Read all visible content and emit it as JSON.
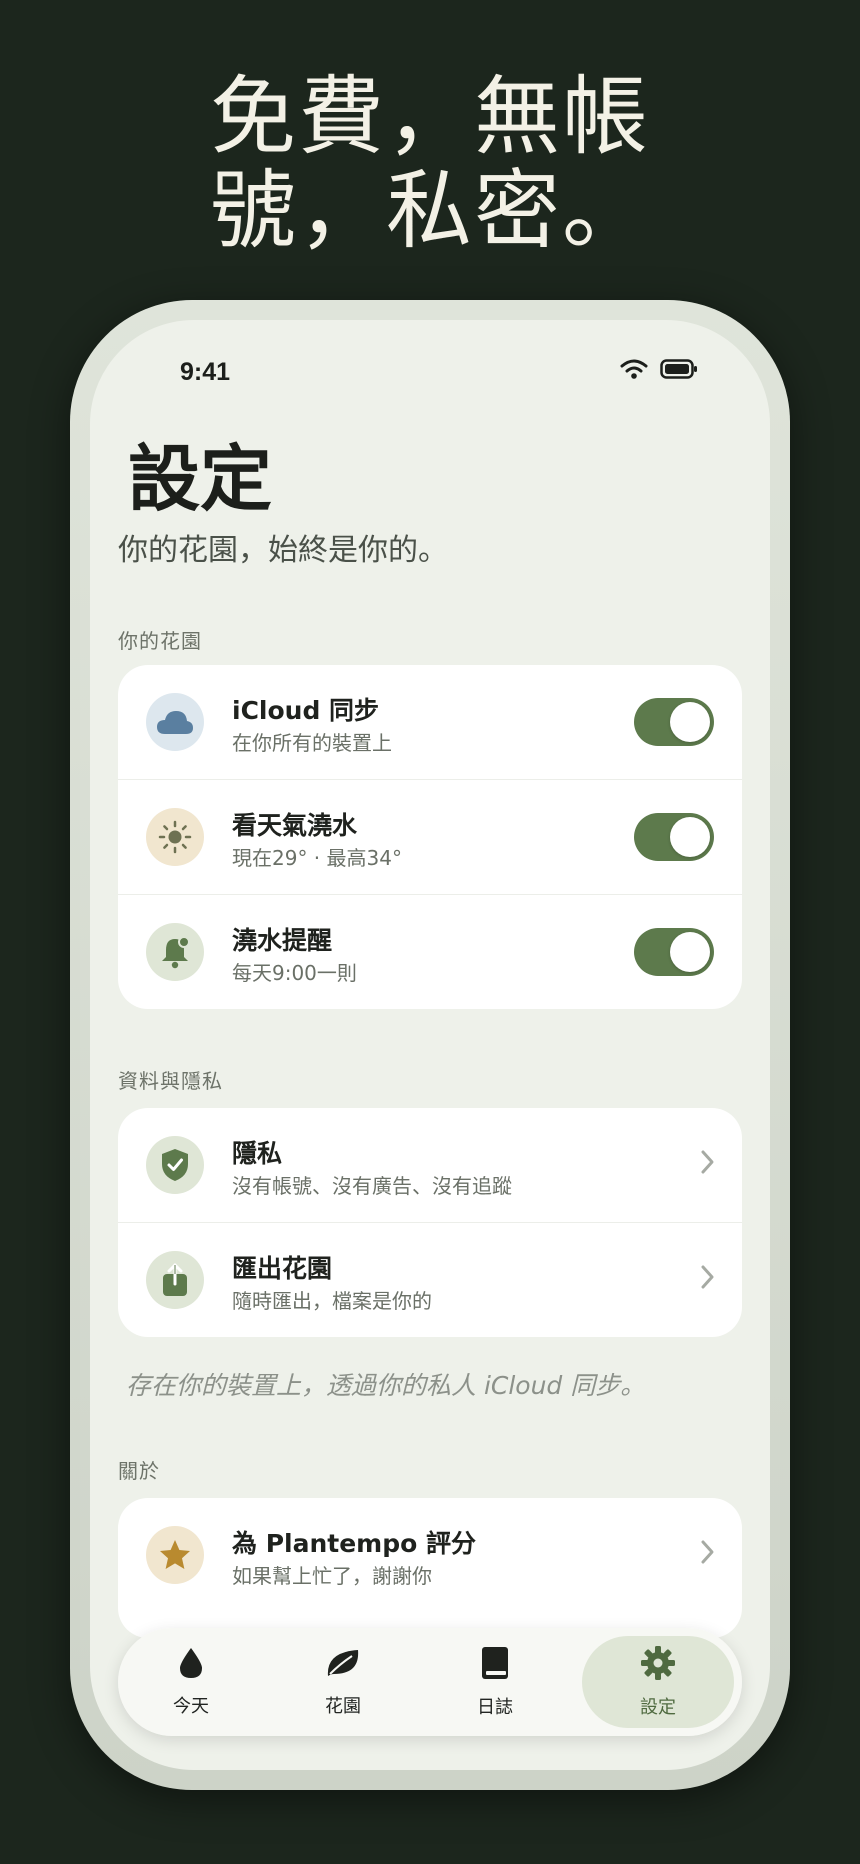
{
  "headline": {
    "line1": "免費，無帳",
    "line2": "號，私密。"
  },
  "status_bar": {
    "time": "9:41"
  },
  "page": {
    "title": "設定",
    "subtitle": "你的花園，始終是你的。"
  },
  "sections": {
    "garden": {
      "label": "你的花園",
      "rows": [
        {
          "title": "iCloud 同步",
          "subtitle": "在你所有的裝置上",
          "icon": "cloud-icon",
          "toggle_on": true
        },
        {
          "title": "看天氣澆水",
          "subtitle": "現在29° · 最高34°",
          "icon": "sun-icon",
          "toggle_on": true
        },
        {
          "title": "澆水提醒",
          "subtitle": "每天9:00一則",
          "icon": "bell-icon",
          "toggle_on": true
        }
      ]
    },
    "data_privacy": {
      "label": "資料與隱私",
      "rows": [
        {
          "title": "隱私",
          "subtitle": "沒有帳號、沒有廣告、沒有追蹤",
          "icon": "shield-check-icon"
        },
        {
          "title": "匯出花園",
          "subtitle": "隨時匯出，檔案是你的",
          "icon": "share-export-icon"
        }
      ],
      "footnote": "存在你的裝置上，透過你的私人 iCloud 同步。"
    },
    "about": {
      "label": "關於",
      "rows": [
        {
          "title": "為 Plantempo 評分",
          "subtitle": "如果幫上忙了，謝謝你",
          "icon": "star-icon"
        }
      ]
    }
  },
  "tabbar": {
    "tabs": [
      {
        "label": "今天",
        "icon": "drop-icon"
      },
      {
        "label": "花園",
        "icon": "leaf-icon"
      },
      {
        "label": "日誌",
        "icon": "book-icon"
      },
      {
        "label": "設定",
        "icon": "gear-icon",
        "active": true
      }
    ]
  },
  "colors": {
    "background": "#1c261d",
    "screen": "#eef1ea",
    "accent_green": "#5d7a4c",
    "active_tab": "#dfe6d6"
  }
}
